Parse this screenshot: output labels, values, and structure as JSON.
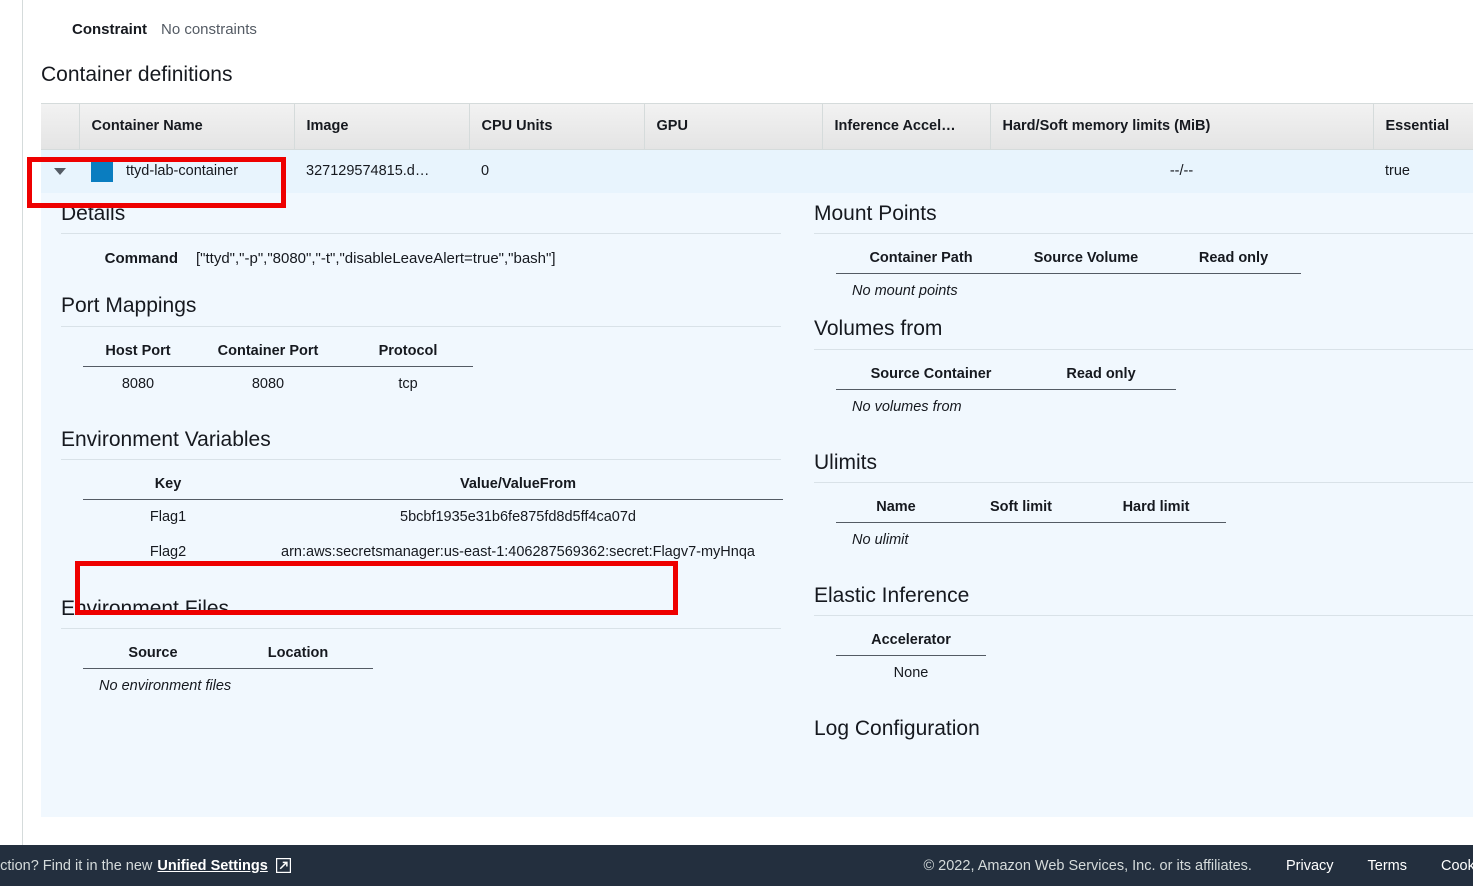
{
  "constraint": {
    "label": "Constraint",
    "value": "No constraints"
  },
  "page_title": "Container definitions",
  "container_table": {
    "columns": [
      "Container Name",
      "Image",
      "CPU Units",
      "GPU",
      "Inference Accel…",
      "Hard/Soft memory limits (MiB)",
      "Essential"
    ],
    "rows": [
      {
        "name": "ttyd-lab-container",
        "image": "327129574815.d…",
        "cpu_units": "0",
        "gpu": "",
        "inference_accelerator": "",
        "memory_limits": "--/--",
        "essential": "true"
      }
    ]
  },
  "details": {
    "title": "Details",
    "command_label": "Command",
    "command_value": "[\"ttyd\",\"-p\",\"8080\",\"-t\",\"disableLeaveAlert=true\",\"bash\"]"
  },
  "port_mappings": {
    "title": "Port Mappings",
    "columns": [
      "Host Port",
      "Container Port",
      "Protocol"
    ],
    "rows": [
      {
        "host_port": "8080",
        "container_port": "8080",
        "protocol": "tcp"
      }
    ]
  },
  "environment_variables": {
    "title": "Environment Variables",
    "columns": [
      "Key",
      "Value/ValueFrom"
    ],
    "rows": [
      {
        "key": "Flag1",
        "value": "5bcbf1935e31b6fe875fd8d5ff4ca07d"
      },
      {
        "key": "Flag2",
        "value": "arn:aws:secretsmanager:us-east-1:406287569362:secret:Flagv7-myHnqa"
      }
    ]
  },
  "environment_files": {
    "title": "Environment Files",
    "columns": [
      "Source",
      "Location"
    ],
    "empty_message": "No environment files"
  },
  "mount_points": {
    "title": "Mount Points",
    "columns": [
      "Container Path",
      "Source Volume",
      "Read only"
    ],
    "empty_message": "No mount points"
  },
  "volumes_from": {
    "title": "Volumes from",
    "columns": [
      "Source Container",
      "Read only"
    ],
    "empty_message": "No volumes from"
  },
  "ulimits": {
    "title": "Ulimits",
    "columns": [
      "Name",
      "Soft limit",
      "Hard limit"
    ],
    "empty_message": "No ulimit"
  },
  "elastic_inference": {
    "title": "Elastic Inference",
    "columns": [
      "Accelerator"
    ],
    "value": "None"
  },
  "log_configuration": {
    "title": "Log Configuration"
  },
  "footer": {
    "left_text": "ection? Find it in the new",
    "left_link": "Unified Settings",
    "copyright": "© 2022, Amazon Web Services, Inc. or its affiliates.",
    "privacy": "Privacy",
    "terms": "Terms",
    "cookie": "Cookie preferences"
  },
  "colors": {
    "accent_blue": "#0a7dc0",
    "row_highlight": "#e8f4fd",
    "detail_bg": "#f1f8fe",
    "footer_bg": "#232f3e",
    "annotation_red": "#ee0000"
  }
}
